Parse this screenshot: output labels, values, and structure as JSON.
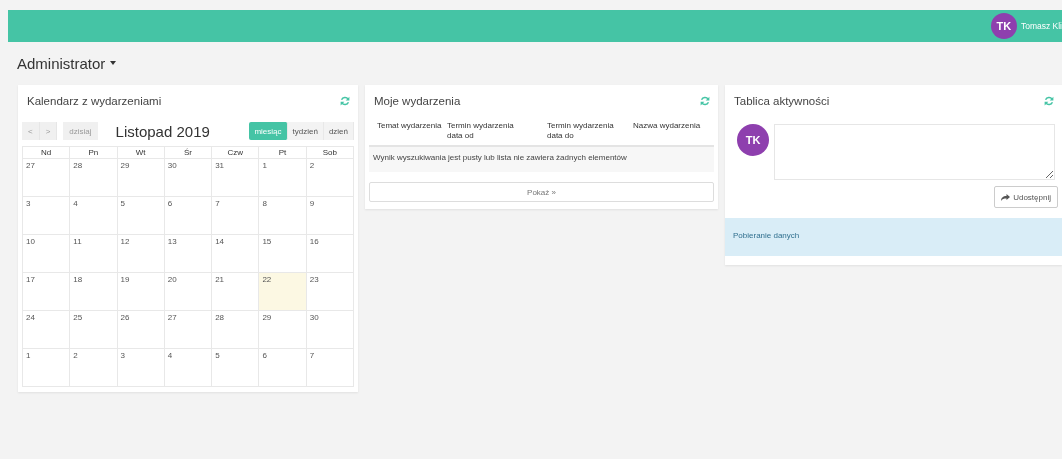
{
  "header": {
    "avatar": "TK",
    "user_name": "Tomasz Kli"
  },
  "page_title": "Administrator",
  "calendar": {
    "title": "Kalendarz z wydarzeniami",
    "nav": [
      "<",
      ">"
    ],
    "today_button": "dzisiaj",
    "month_title": "Listopad 2019",
    "views": [
      {
        "label": "miesiąc",
        "selected": true
      },
      {
        "label": "tydzień",
        "selected": false
      },
      {
        "label": "dzień",
        "selected": false
      }
    ],
    "weekdays": [
      "Nd",
      "Pn",
      "Wt",
      "Śr",
      "Czw",
      "Pt",
      "Sob"
    ],
    "weeks": [
      [
        {
          "day": "27",
          "today": false
        },
        {
          "day": "28",
          "today": false
        },
        {
          "day": "29",
          "today": false
        },
        {
          "day": "30",
          "today": false
        },
        {
          "day": "31",
          "today": false
        },
        {
          "day": "1",
          "today": false
        },
        {
          "day": "2",
          "today": false
        }
      ],
      [
        {
          "day": "3",
          "today": false
        },
        {
          "day": "4",
          "today": false
        },
        {
          "day": "5",
          "today": false
        },
        {
          "day": "6",
          "today": false
        },
        {
          "day": "7",
          "today": false
        },
        {
          "day": "8",
          "today": false
        },
        {
          "day": "9",
          "today": false
        }
      ],
      [
        {
          "day": "10",
          "today": false
        },
        {
          "day": "11",
          "today": false
        },
        {
          "day": "12",
          "today": false
        },
        {
          "day": "13",
          "today": false
        },
        {
          "day": "14",
          "today": false
        },
        {
          "day": "15",
          "today": false
        },
        {
          "day": "16",
          "today": false
        }
      ],
      [
        {
          "day": "17",
          "today": false
        },
        {
          "day": "18",
          "today": false
        },
        {
          "day": "19",
          "today": false
        },
        {
          "day": "20",
          "today": false
        },
        {
          "day": "21",
          "today": false
        },
        {
          "day": "22",
          "today": true
        },
        {
          "day": "23",
          "today": false
        }
      ],
      [
        {
          "day": "24",
          "today": false
        },
        {
          "day": "25",
          "today": false
        },
        {
          "day": "26",
          "today": false
        },
        {
          "day": "27",
          "today": false
        },
        {
          "day": "28",
          "today": false
        },
        {
          "day": "29",
          "today": false
        },
        {
          "day": "30",
          "today": false
        }
      ],
      [
        {
          "day": "1",
          "today": false
        },
        {
          "day": "2",
          "today": false
        },
        {
          "day": "3",
          "today": false
        },
        {
          "day": "4",
          "today": false
        },
        {
          "day": "5",
          "today": false
        },
        {
          "day": "6",
          "today": false
        },
        {
          "day": "7",
          "today": false
        }
      ]
    ]
  },
  "events": {
    "title": "Moje wydarzenia",
    "columns": [
      "Temat wydarzenia",
      "Termin wydarzenia data od",
      "Termin wydarzenia data do",
      "Nazwa wydarzenia"
    ],
    "empty_message": "Wynik wyszukiwania jest pusty lub lista nie zawiera żadnych elementów",
    "show_button": "Pokaż »"
  },
  "activity": {
    "title": "Tablica aktywności",
    "avatar": "TK",
    "share_button": "Udostępnij",
    "status": "Pobieranie danych"
  }
}
